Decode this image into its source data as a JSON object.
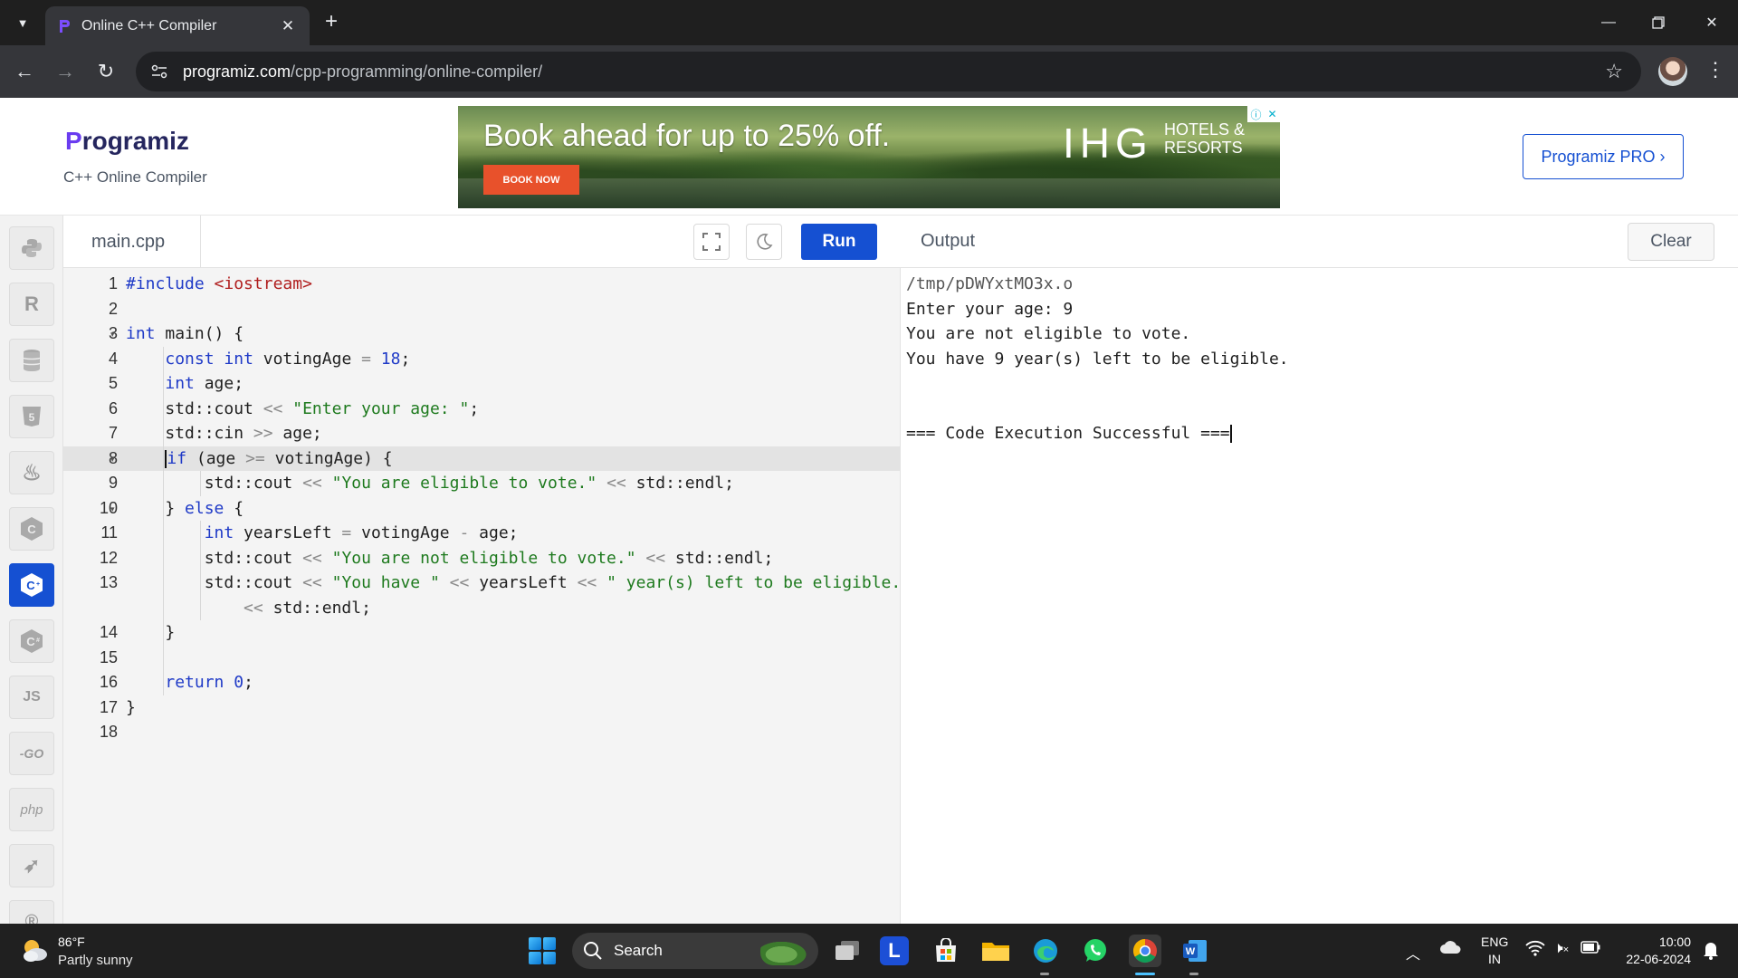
{
  "browser": {
    "tab_title": "Online C++ Compiler",
    "url_host": "programiz.com",
    "url_path": "/cpp-programming/online-compiler/"
  },
  "header": {
    "logo_text": "rogramiz",
    "logo_letter": "P",
    "subtitle": "C++ Online Compiler",
    "pro_button": "Programiz PRO ›"
  },
  "ad": {
    "headline": "Book ahead for up to 25% off.",
    "cta": "BOOK NOW",
    "brand": "IHG",
    "brand_sub_1": "HOTELS &",
    "brand_sub_2": "RESORTS"
  },
  "sidebar": {
    "languages": [
      {
        "name": "python",
        "glyph": "🐍"
      },
      {
        "name": "r",
        "glyph": "R"
      },
      {
        "name": "sql",
        "glyph": "≣"
      },
      {
        "name": "html",
        "glyph": "5"
      },
      {
        "name": "java",
        "glyph": "♨"
      },
      {
        "name": "c",
        "glyph": "C"
      },
      {
        "name": "cpp",
        "glyph": "C",
        "active": true
      },
      {
        "name": "csharp",
        "glyph": "C"
      },
      {
        "name": "js",
        "glyph": "JS"
      },
      {
        "name": "go",
        "glyph": "GO"
      },
      {
        "name": "php",
        "glyph": "php"
      },
      {
        "name": "swift",
        "glyph": "➶"
      },
      {
        "name": "rust",
        "glyph": "R"
      }
    ]
  },
  "editor": {
    "file_name": "main.cpp",
    "run_label": "Run",
    "active_line": 8,
    "line_numbers": [
      "1",
      "2",
      "3",
      "4",
      "5",
      "6",
      "7",
      "8",
      "9",
      "10",
      "11",
      "12",
      "13",
      "",
      "14",
      "15",
      "16",
      "17",
      "18"
    ],
    "code": [
      "#include <iostream>",
      "",
      "int main() {",
      "    const int votingAge = 18;",
      "    int age;",
      "    std::cout << \"Enter your age: \";",
      "    std::cin >> age;",
      "    if (age >= votingAge) {",
      "        std::cout << \"You are eligible to vote.\" << std::endl;",
      "    } else {",
      "        int yearsLeft = votingAge - age;",
      "        std::cout << \"You are not eligible to vote.\" << std::endl;",
      "        std::cout << \"You have \" << yearsLeft << \" year(s) left to be eligible.\"",
      "            << std::endl;",
      "    }",
      "",
      "    return 0;",
      "}",
      ""
    ]
  },
  "output": {
    "title": "Output",
    "clear_label": "Clear",
    "lines": [
      "/tmp/pDWYxtMO3x.o",
      "Enter your age: 9",
      "You are not eligible to vote.",
      "You have 9 year(s) left to be eligible.",
      "",
      "",
      "=== Code Execution Successful ==="
    ]
  },
  "taskbar": {
    "weather_temp": "86°F",
    "weather_desc": "Partly sunny",
    "search_label": "Search",
    "lang_1": "ENG",
    "lang_2": "IN",
    "time": "10:00",
    "date": "22-06-2024"
  }
}
